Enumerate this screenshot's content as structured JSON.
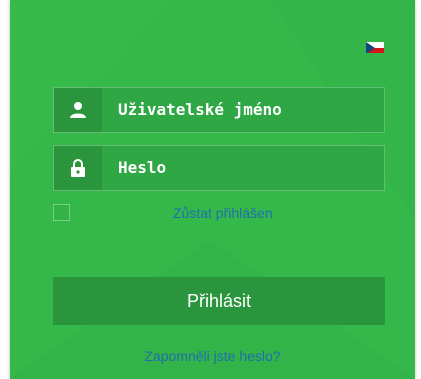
{
  "language": {
    "flag": "czech-flag-icon"
  },
  "form": {
    "username_value": "Uživatelské jméno",
    "password_value": "Heslo",
    "remember_label": "Zůstat přihlášen",
    "login_label": "Přihlásit",
    "forgot_label": "Zapomněli jste heslo?"
  },
  "colors": {
    "panel": "#35b84a",
    "field": "#2fa744",
    "icon_box": "#2a953c",
    "link": "#1f6fb0"
  }
}
